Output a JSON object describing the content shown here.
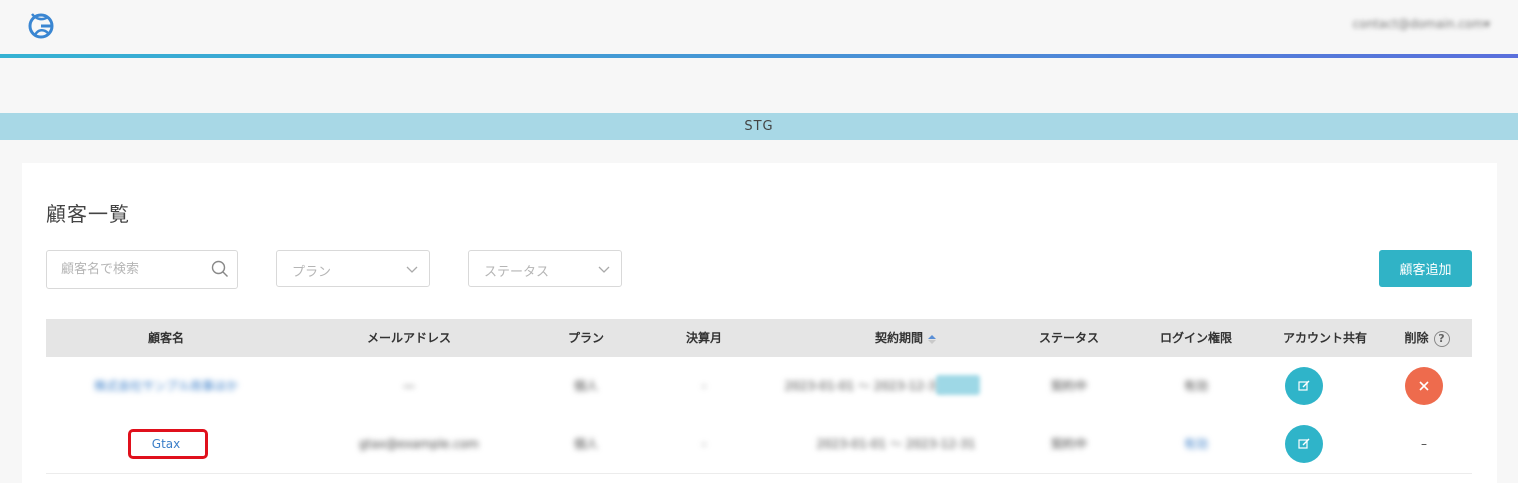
{
  "header": {
    "logo_name": "logo-icon",
    "account": "contact@domain.com▾"
  },
  "env": {
    "label": "STG"
  },
  "page": {
    "title": "顧客一覧"
  },
  "filters": {
    "search_placeholder": "顧客名で検索",
    "plan_placeholder": "プラン",
    "status_placeholder": "ステータス"
  },
  "actions": {
    "add_customer": "顧客追加"
  },
  "table": {
    "columns": [
      "顧客名",
      "メールアドレス",
      "プラン",
      "決算月",
      "契約期間",
      "ステータス",
      "ログイン権限",
      "アカウント共有",
      "削除"
    ],
    "rows": [
      {
        "customer_name": "株式会社サンプル商事ほか",
        "email": "—",
        "plan": "個人",
        "closing_month": "-",
        "contract_period": "2023-01-01 〜 2023-12-31",
        "status": "契約中",
        "login": "有効"
      },
      {
        "customer_name": "Gtax",
        "email": "gtax@example.com",
        "plan": "個人",
        "closing_month": "-",
        "contract_period": "2023-01-01 〜 2023-12-31",
        "status": "契約中",
        "login": "有効",
        "delete": "–"
      }
    ]
  },
  "colors": {
    "accent": "#30b3c6",
    "danger": "#ee6b4d",
    "env_banner": "#a8d8e6",
    "highlight": "#e0101c"
  }
}
